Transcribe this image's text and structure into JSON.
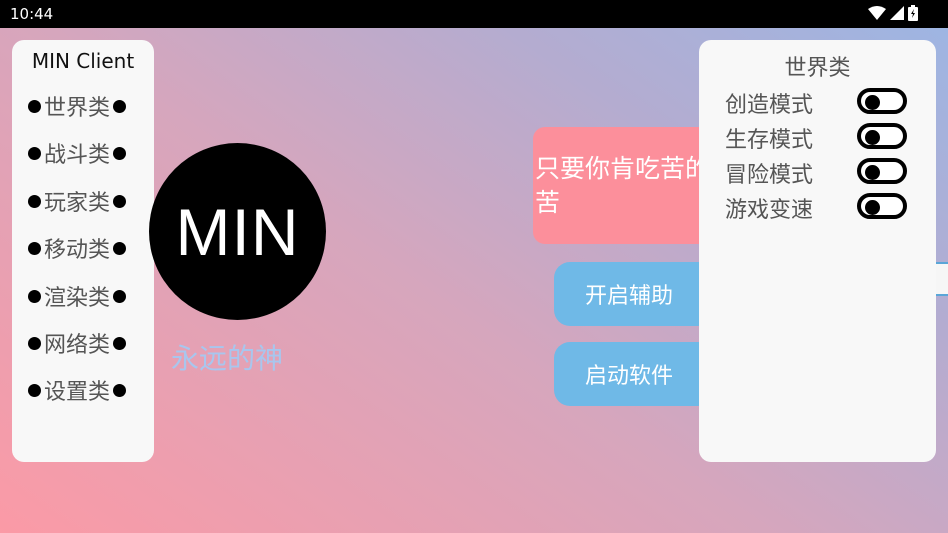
{
  "status": {
    "time": "10:44"
  },
  "left_panel": {
    "title": "MIN Client",
    "items": [
      {
        "label": "世界类"
      },
      {
        "label": "战斗类"
      },
      {
        "label": "玩家类"
      },
      {
        "label": "移动类"
      },
      {
        "label": "渲染类"
      },
      {
        "label": "网络类"
      },
      {
        "label": "设置类"
      }
    ]
  },
  "logo": {
    "text": "MIN",
    "subtitle": "永远的神"
  },
  "slogan": "只要你肯吃苦的苦",
  "buttons": {
    "assist": "开启辅助",
    "launch": "启动软件"
  },
  "right_panel": {
    "title": "世界类",
    "modes": [
      {
        "label": "创造模式",
        "enabled": false
      },
      {
        "label": "生存模式",
        "enabled": false
      },
      {
        "label": "冒险模式",
        "enabled": false
      },
      {
        "label": "游戏变速",
        "enabled": false
      }
    ]
  },
  "colors": {
    "slogan_bg": "#fc8f9b",
    "button_bg": "#6fb9e7",
    "subtitle": "#a8c6ee",
    "panel_bg": "#f8f8f8"
  }
}
